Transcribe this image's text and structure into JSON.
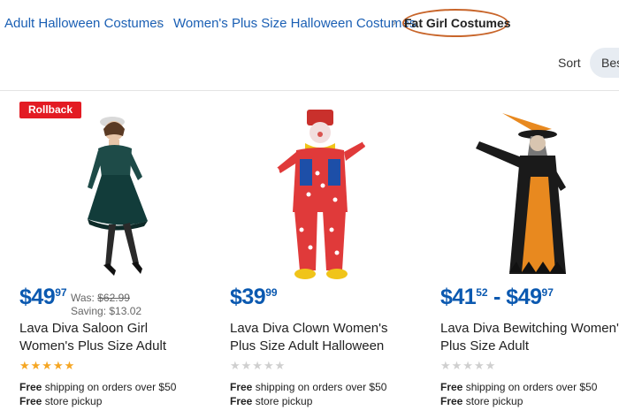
{
  "breadcrumb": {
    "items": [
      "Adult Halloween Costumes",
      "Women's Plus Size Halloween Costumes"
    ],
    "current": "Fat Girl Costumes",
    "separator": "›"
  },
  "sort": {
    "label": "Sort",
    "value": "Bes"
  },
  "products": [
    {
      "badge": "Rollback",
      "price_dollars": "$49",
      "price_cents": "97",
      "was_label": "Was: ",
      "was_price": "$62.99",
      "saving": "Saving: $13.02",
      "title": "Lava Diva Saloon Girl Women's Plus Size Adult",
      "rating": 5,
      "shipping_bold": "Free",
      "shipping_text": " shipping on orders over $50",
      "pickup_bold": "Free",
      "pickup_text": " store pickup"
    },
    {
      "price_dollars": "$39",
      "price_cents": "99",
      "title": "Lava Diva Clown Women's Plus Size Adult Halloween",
      "rating": 0,
      "shipping_bold": "Free",
      "shipping_text": " shipping on orders over $50",
      "pickup_bold": "Free",
      "pickup_text": " store pickup"
    },
    {
      "price_dollars": "$41",
      "price_cents": "52",
      "range_sep": " - ",
      "price2_dollars": "$49",
      "price2_cents": "97",
      "title": "Lava Diva Bewitching Women's Plus Size Adult",
      "rating": 0,
      "shipping_bold": "Free",
      "shipping_text": " shipping on orders over $50",
      "pickup_bold": "Free",
      "pickup_text": " store pickup"
    }
  ],
  "colors": {
    "link": "#1a5fb4",
    "price": "#0b59b0",
    "rollback": "#e31b23",
    "highlight": "#c8652a",
    "star": "#f5a623"
  }
}
